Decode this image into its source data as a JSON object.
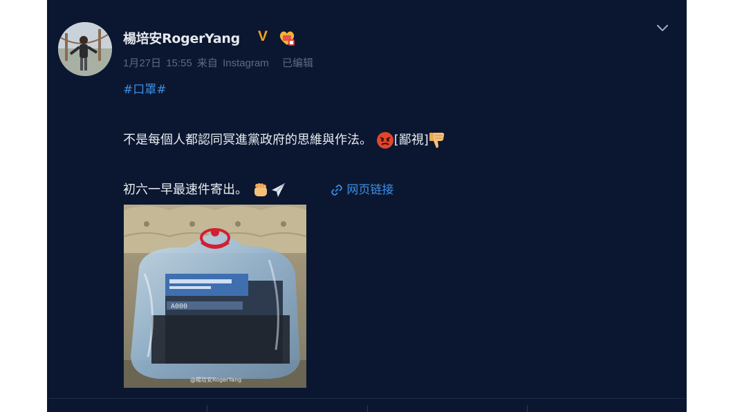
{
  "post": {
    "user": {
      "name": "楊培安RogerYang",
      "verified_mark": "V",
      "verified_color": "#f6a41b",
      "badge_icon": "heart-badge-icon"
    },
    "meta": {
      "date": "1月27日",
      "time": "15:55",
      "source_prefix": "来自",
      "source": "Instagram",
      "edited": "已编辑"
    },
    "hashtag": "#口罩#",
    "line1": {
      "text": "不是每個人都認同冥進黨政府的思維與作法。",
      "emoji_label": "[鄙視]"
    },
    "line2": {
      "text": "初六一早最速件寄出。"
    },
    "web_link": "网页链接",
    "image": {
      "watermark": "@楊培安RogerYang"
    }
  },
  "colors": {
    "background": "#0b1730",
    "link": "#3b8fe6",
    "text": "#e8ecf1",
    "meta": "#5e6a7f"
  }
}
